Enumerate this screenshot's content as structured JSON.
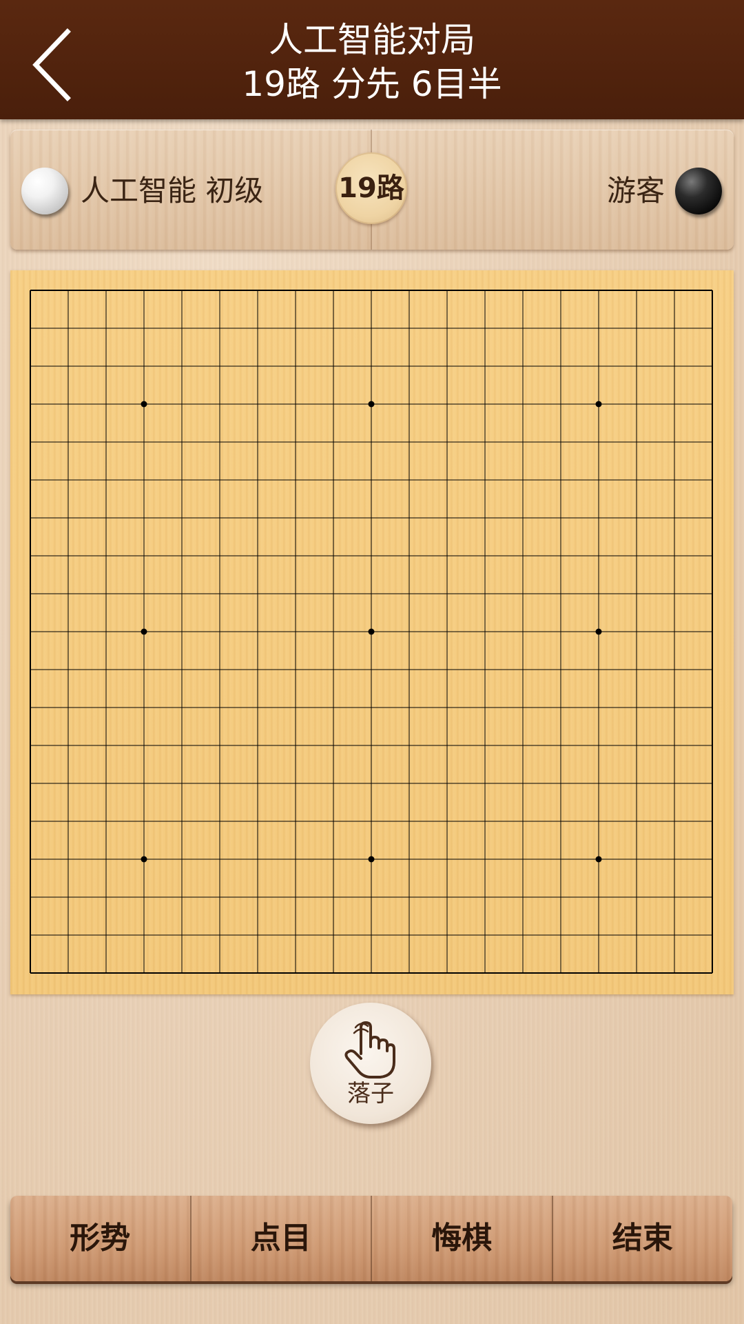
{
  "header": {
    "title": "人工智能对局",
    "subtitle": "19路 分先 6目半",
    "back_icon": "chevron-left-icon"
  },
  "players": {
    "white": {
      "name": "人工智能 初级",
      "stone_color": "#ffffff"
    },
    "black": {
      "name": "游客",
      "stone_color": "#000000"
    },
    "board_size_label": "19路"
  },
  "board": {
    "size": 19,
    "star_points": [
      [
        3,
        3
      ],
      [
        3,
        9
      ],
      [
        3,
        15
      ],
      [
        9,
        3
      ],
      [
        9,
        9
      ],
      [
        9,
        15
      ],
      [
        15,
        3
      ],
      [
        15,
        9
      ],
      [
        15,
        15
      ]
    ],
    "stones": [],
    "line_color": "#000000",
    "wood_color": "#f5cb7e"
  },
  "place_button": {
    "label": "落子",
    "icon": "hand-pointer-icon"
  },
  "toolbar": {
    "items": [
      "形势",
      "点目",
      "悔棋",
      "结束"
    ]
  },
  "colors": {
    "header_bg": "#4e210d",
    "text_dark": "#2a160a"
  }
}
